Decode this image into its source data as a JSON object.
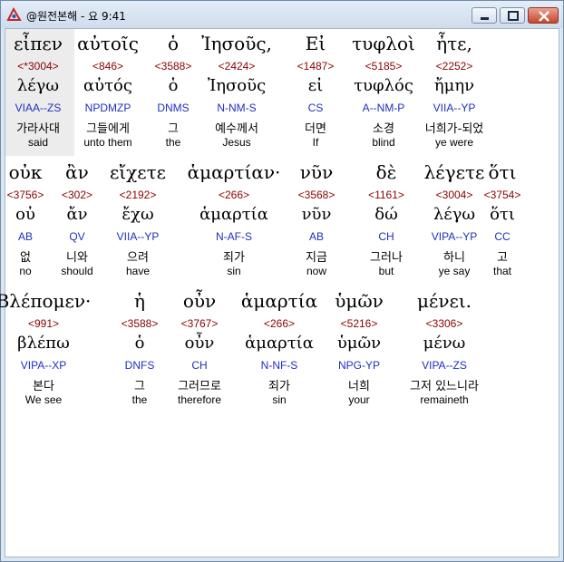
{
  "window": {
    "title": "@원전본해 - 요 9:41"
  },
  "verse": {
    "lines": [
      {
        "tokens": [
          {
            "greek": "εἶπεν",
            "strong": "<*3004>",
            "lemma": "λέγω",
            "parse": "VIAA--ZS",
            "korean": "가라사대",
            "english": "said"
          },
          {
            "greek": "αὐτοῖς",
            "strong": "<846>",
            "lemma": "αὐτός",
            "parse": "NPDMZP",
            "korean": "그들에게",
            "english": "unto them"
          },
          {
            "greek": "ὁ",
            "strong": "<3588>",
            "lemma": "ὁ",
            "parse": "DNMS",
            "korean": "그",
            "english": "the"
          },
          {
            "greek": "Ἰησοῦς,",
            "strong": "<2424>",
            "lemma": "Ἰησοῦς",
            "parse": "N-NM-S",
            "korean": "예수께서",
            "english": "Jesus"
          },
          {
            "greek": "Εἰ",
            "strong": "<1487>",
            "lemma": "εἰ",
            "parse": "CS",
            "korean": "더면",
            "english": "If"
          },
          {
            "greek": "τυφλοὶ",
            "strong": "<5185>",
            "lemma": "τυφλός",
            "parse": "A--NM-P",
            "korean": "소경",
            "english": "blind"
          },
          {
            "greek": "ἦτε,",
            "strong": "<2252>",
            "lemma": "ἤμην",
            "parse": "VIIA--YP",
            "korean": "너희가-되었",
            "english": "ye were"
          }
        ]
      },
      {
        "tokens": [
          {
            "greek": "οὐκ",
            "strong": "<3756>",
            "lemma": "οὐ",
            "parse": "AB",
            "korean": "없",
            "english": "no"
          },
          {
            "greek": "ἂν",
            "strong": "<302>",
            "lemma": "ἄν",
            "parse": "QV",
            "korean": "니와",
            "english": "should"
          },
          {
            "greek": "εἴχετε",
            "strong": "<2192>",
            "lemma": "ἔχω",
            "parse": "VIIA--YP",
            "korean": "으려",
            "english": "have"
          },
          {
            "greek": "ἁμαρτίαν·",
            "strong": "<266>",
            "lemma": "ἁμαρτία",
            "parse": "N-AF-S",
            "korean": "죄가",
            "english": "sin"
          },
          {
            "greek": "νῦν",
            "strong": "<3568>",
            "lemma": "νῦν",
            "parse": "AB",
            "korean": "지금",
            "english": "now"
          },
          {
            "greek": "δὲ",
            "strong": "<1161>",
            "lemma": "δώ",
            "parse": "CH",
            "korean": "그러나",
            "english": "but"
          },
          {
            "greek": "λέγετε",
            "strong": "<3004>",
            "lemma": "λέγω",
            "parse": "VIPA--YP",
            "korean": "하니",
            "english": "ye say"
          },
          {
            "greek": "ὅτι",
            "strong": "<3754>",
            "lemma": "ὅτι",
            "parse": "CC",
            "korean": "고",
            "english": "that"
          }
        ]
      },
      {
        "tokens": [
          {
            "greek": "Βλέπομεν·",
            "strong": "<991>",
            "lemma": "βλέπω",
            "parse": "VIPA--XP",
            "korean": "본다",
            "english": "We see"
          },
          {
            "greek": "ἡ",
            "strong": "<3588>",
            "lemma": "ὁ",
            "parse": "DNFS",
            "korean": "그",
            "english": "the"
          },
          {
            "greek": "οὖν",
            "strong": "<3767>",
            "lemma": "οὖν",
            "parse": "CH",
            "korean": "그러므로",
            "english": "therefore"
          },
          {
            "greek": "ἁμαρτία",
            "strong": "<266>",
            "lemma": "ἁμαρτία",
            "parse": "N-NF-S",
            "korean": "죄가",
            "english": "sin"
          },
          {
            "greek": "ὑμῶν",
            "strong": "<5216>",
            "lemma": "ὑμῶν",
            "parse": "NPG-YP",
            "korean": "너희",
            "english": "your"
          },
          {
            "greek": "μένει.",
            "strong": "<3306>",
            "lemma": "μένω",
            "parse": "VIPA--ZS",
            "korean": "그저 있느니라",
            "english": "remaineth"
          }
        ]
      }
    ]
  },
  "colors": {
    "strong": "#8b0000",
    "parse": "#1f2fc0",
    "selection": "#ececec"
  }
}
